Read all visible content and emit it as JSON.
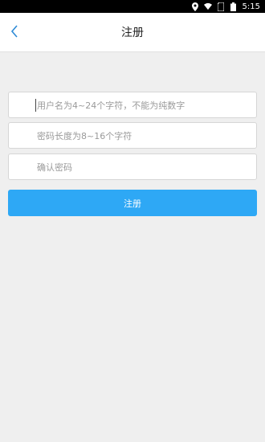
{
  "status_bar": {
    "time": "5:15"
  },
  "header": {
    "title": "注册"
  },
  "form": {
    "username": {
      "placeholder": "用户名为4~24个字符，不能为纯数字",
      "value": ""
    },
    "password": {
      "placeholder": "密码长度为8~16个字符",
      "value": ""
    },
    "confirm_password": {
      "placeholder": "确认密码",
      "value": ""
    },
    "submit_label": "注册"
  },
  "colors": {
    "accent": "#2ea8f5",
    "back_icon": "#2e8bd6"
  }
}
